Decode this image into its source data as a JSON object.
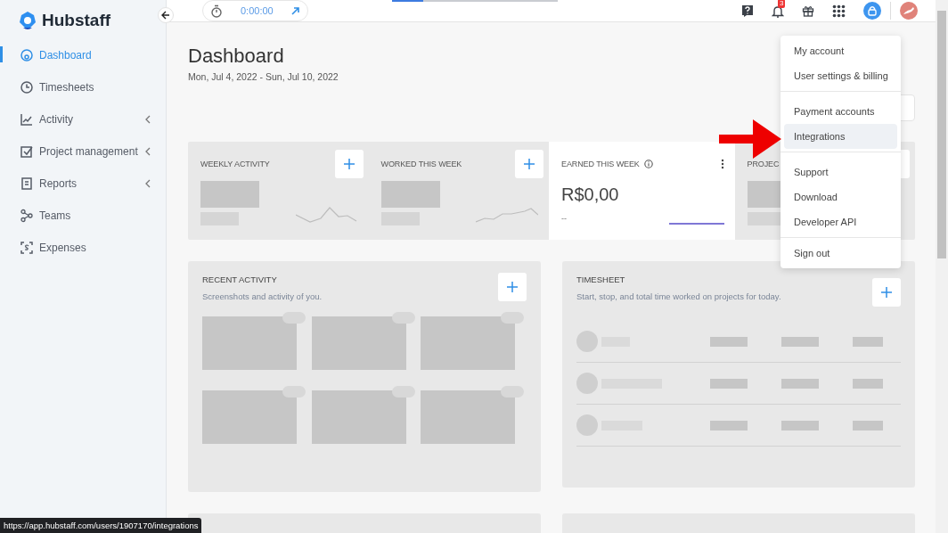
{
  "loading_bar": {
    "level": 0.19
  },
  "logo": {
    "text": "Hubstaff"
  },
  "sidebar": {
    "items": [
      {
        "label": "Dashboard",
        "selected": true,
        "submenu": false
      },
      {
        "label": "Timesheets",
        "selected": false,
        "submenu": false
      },
      {
        "label": "Activity",
        "selected": false,
        "submenu": true
      },
      {
        "label": "Project management",
        "selected": false,
        "submenu": true
      },
      {
        "label": "Reports",
        "selected": false,
        "submenu": true
      },
      {
        "label": "Teams",
        "selected": false,
        "submenu": false
      },
      {
        "label": "Expenses",
        "selected": false,
        "submenu": false
      }
    ]
  },
  "timer": {
    "time": "0:00:00"
  },
  "notifications": {
    "count": "3"
  },
  "page": {
    "title": "Dashboard",
    "date_range": "Mon, Jul 4, 2022 - Sun, Jul 10, 2022"
  },
  "stat_cards": [
    {
      "kind": "loading",
      "title": "WEEKLY ACTIVITY"
    },
    {
      "kind": "loading",
      "title": "WORKED THIS WEEK"
    },
    {
      "kind": "value",
      "title": "EARNED THIS WEEK",
      "value": "R$0,00",
      "change": "--"
    },
    {
      "kind": "loading",
      "title": "PROJEC"
    }
  ],
  "widgets": [
    {
      "kind": "screenshots",
      "title": "RECENT ACTIVITY",
      "subtitle": "Screenshots and activity of you."
    },
    {
      "kind": "timesheet",
      "title": "TIMESHEET",
      "subtitle": "Start, stop, and total time worked on projects for today."
    }
  ],
  "account_menu": {
    "groups": [
      [
        {
          "label": "My account",
          "selected": false
        },
        {
          "label": "User settings & billing",
          "selected": false
        }
      ],
      [
        {
          "label": "Payment accounts",
          "selected": false
        },
        {
          "label": "Integrations",
          "selected": true
        }
      ],
      [
        {
          "label": "Support",
          "selected": false
        },
        {
          "label": "Download",
          "selected": false
        },
        {
          "label": "Developer API",
          "selected": false
        }
      ],
      [
        {
          "label": "Sign out",
          "selected": false
        }
      ]
    ]
  },
  "status_url": "https://app.hubstaff.com/users/1907170/integrations"
}
